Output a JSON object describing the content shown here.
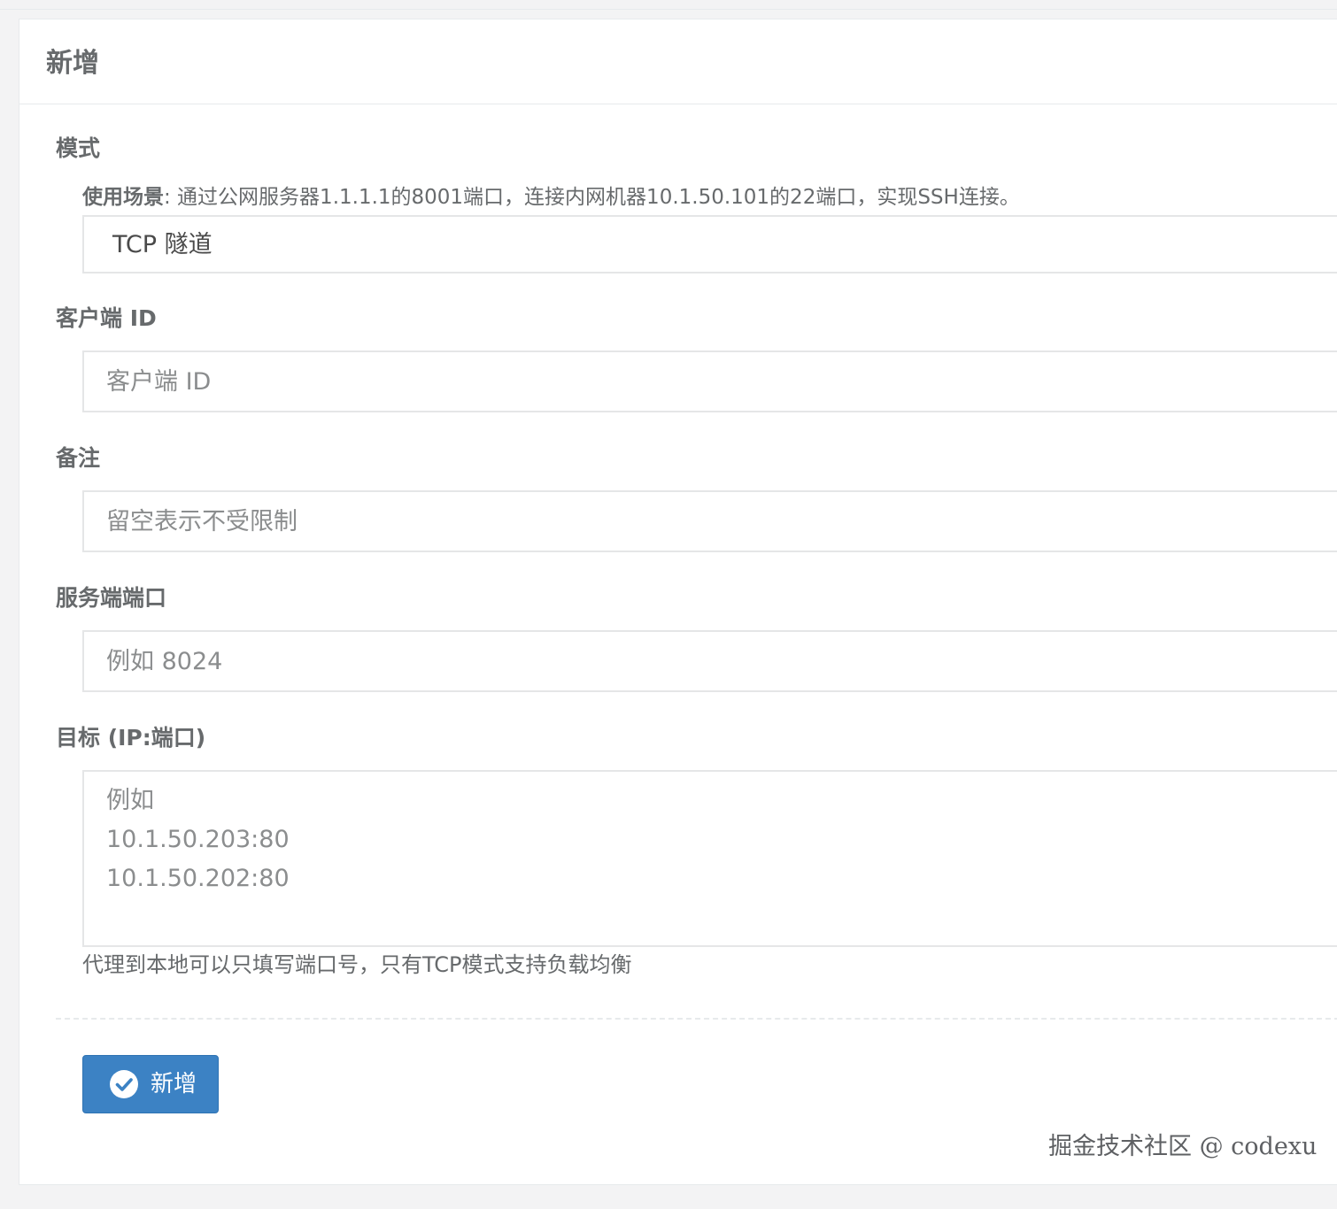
{
  "panel": {
    "title": "新增"
  },
  "form": {
    "mode": {
      "label": "模式",
      "hint_prefix": "使用场景",
      "hint_text": ": 通过公网服务器1.1.1.1的8001端口，连接内网机器10.1.50.101的22端口，实现SSH连接。",
      "selected": "TCP 隧道"
    },
    "client_id": {
      "label": "客户端 ID",
      "placeholder": "客户端 ID",
      "value": ""
    },
    "remark": {
      "label": "备注",
      "placeholder": "留空表示不受限制",
      "value": ""
    },
    "server_port": {
      "label": "服务端端口",
      "placeholder": "例如 8024",
      "value": ""
    },
    "target": {
      "label": "目标 (IP:端口)",
      "placeholder_lines": [
        "例如",
        "10.1.50.203:80",
        "10.1.50.202:80"
      ],
      "help": "代理到本地可以只填写端口号，只有TCP模式支持负载均衡"
    }
  },
  "actions": {
    "submit_label": "新增"
  },
  "watermark": "掘金技术社区 @ codexu",
  "colors": {
    "primary_button": "#3c82c4",
    "text": "#676a6c",
    "border": "#e5e6e7"
  }
}
